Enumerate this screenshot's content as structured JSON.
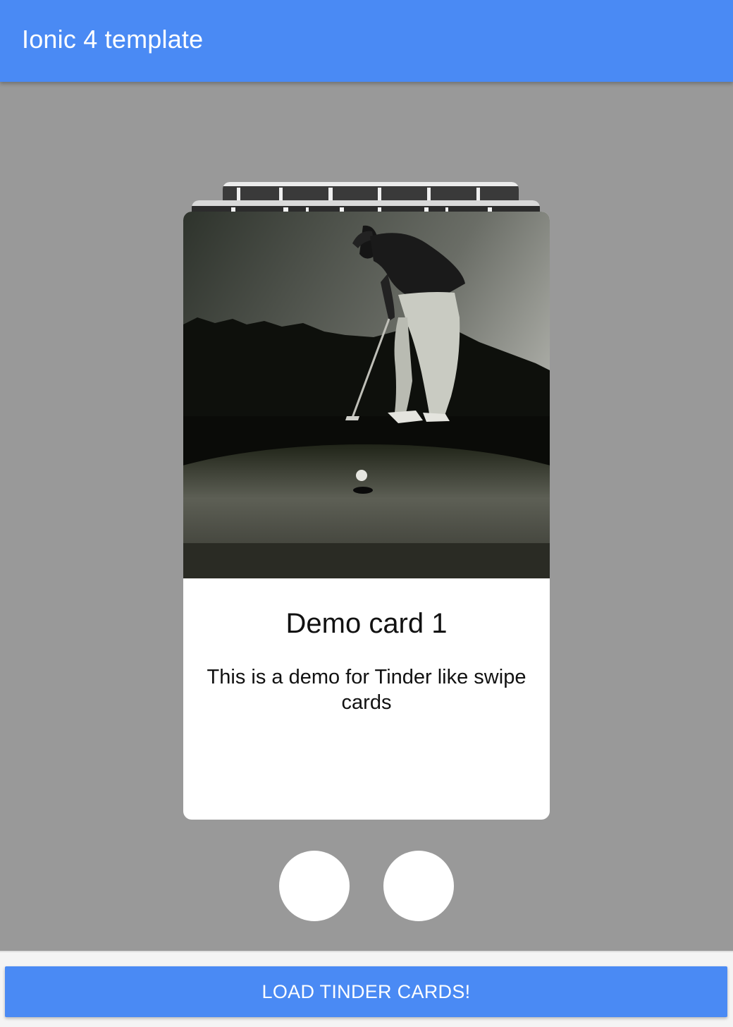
{
  "toolbar": {
    "title": "Ionic 4 template"
  },
  "card": {
    "title": "Demo card 1",
    "description": "This is a demo for Tinder like swipe cards",
    "image": "golfer-putting-photo"
  },
  "actions": {
    "left_icon": "dislike-icon",
    "right_icon": "like-icon"
  },
  "footer": {
    "button_label": "LOAD TINDER CARDS!"
  },
  "colors": {
    "primary": "#4a8af4",
    "background": "#999999",
    "card": "#ffffff"
  }
}
